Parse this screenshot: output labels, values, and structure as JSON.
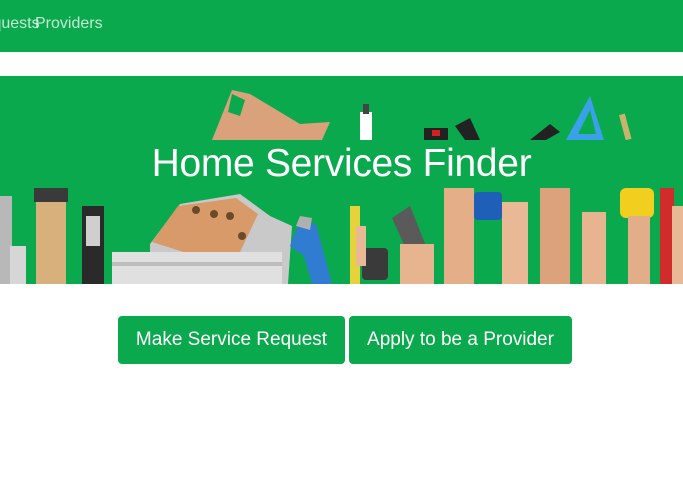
{
  "nav": {
    "links": [
      {
        "label": "Requests"
      },
      {
        "label": "Providers"
      }
    ]
  },
  "hero": {
    "title": "Home Services Finder",
    "image_icon": "tools-in-hands-banner"
  },
  "actions": {
    "request_label": "Make Service Request",
    "apply_label": "Apply to be a Provider"
  },
  "colors": {
    "brand_green": "#0aa94d",
    "nav_text": "rgba(255,255,255,0.75)",
    "button_text": "#ffffff"
  }
}
